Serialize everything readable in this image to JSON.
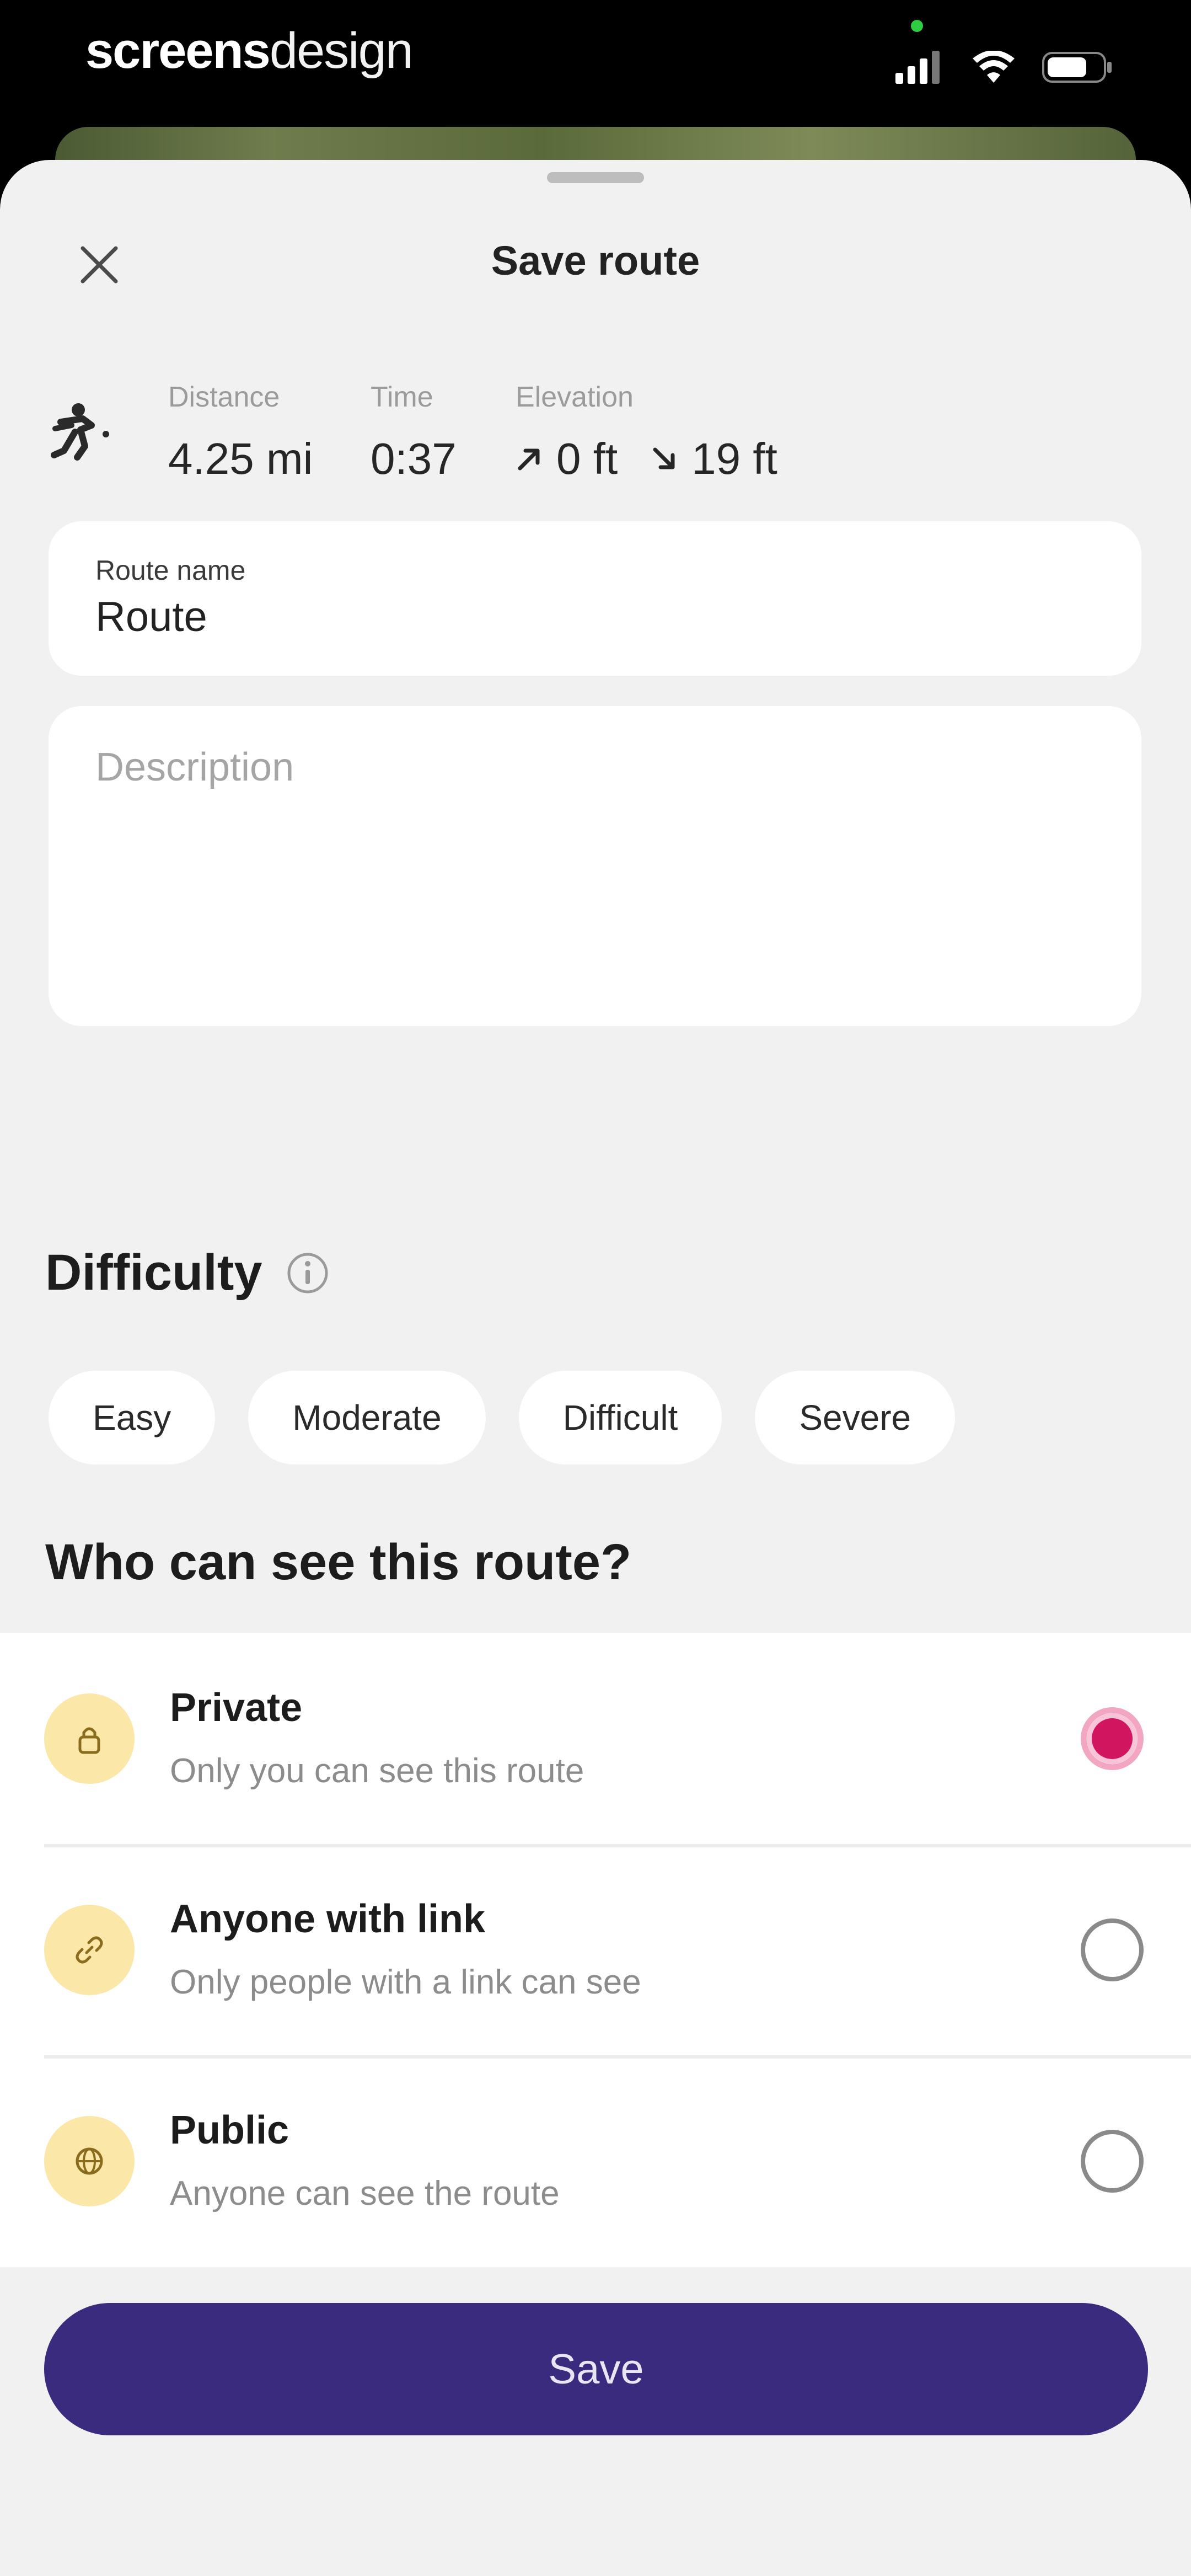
{
  "status_bar": {
    "brand_bold": "screens",
    "brand_light": "design"
  },
  "sheet": {
    "title": "Save route",
    "close_icon": "close-icon"
  },
  "stats": {
    "activity_icon": "hiking-icon",
    "distance_label": "Distance",
    "distance_value": "4.25 mi",
    "time_label": "Time",
    "time_value": "0:37",
    "elevation_label": "Elevation",
    "elevation_up": "0 ft",
    "elevation_down": "19 ft"
  },
  "route_name": {
    "label": "Route name",
    "value": "Route"
  },
  "description": {
    "placeholder": "Description"
  },
  "difficulty": {
    "heading": "Difficulty",
    "options": [
      "Easy",
      "Moderate",
      "Difficult",
      "Severe"
    ]
  },
  "visibility": {
    "heading": "Who can see this route?",
    "selected": "Private",
    "options": [
      {
        "title": "Private",
        "subtitle": "Only you can see this route",
        "icon": "lock-icon"
      },
      {
        "title": "Anyone with link",
        "subtitle": "Only people with a link can see",
        "icon": "link-icon"
      },
      {
        "title": "Public",
        "subtitle": "Anyone can see the route",
        "icon": "globe-icon"
      }
    ]
  },
  "save_label": "Save",
  "colors": {
    "accent": "#3b2b7e",
    "radio_selected": "#d1155f",
    "icon_bg": "#fbe7a8",
    "sheet_bg": "#f1f1f1"
  }
}
